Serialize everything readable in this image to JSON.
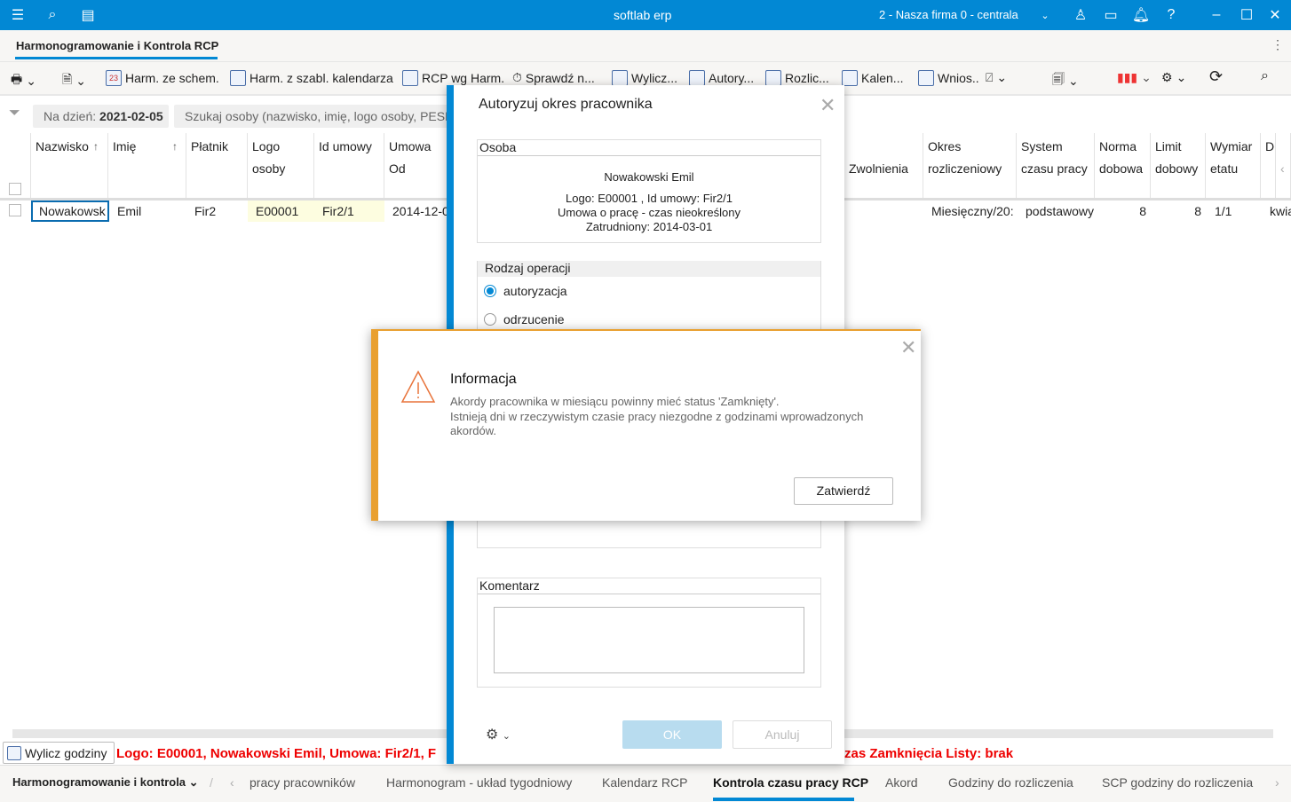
{
  "app": {
    "title": "softlab erp",
    "company": "2 - Nasza firma 0 - centrala"
  },
  "tab": {
    "label": "Harmonogramowanie i Kontrola RCP"
  },
  "toolbar": {
    "items": [
      "Harm. ze schem.",
      "Harm. z szabl. kalendarza",
      "RCP wg Harm.",
      "Sprawdź n...",
      "Wylicz...",
      "Autory...",
      "Rozlic...",
      "Kalen...",
      "Wnios.."
    ]
  },
  "filter": {
    "date_label": "Na dzień:",
    "date_value": "2021-02-05",
    "search_placeholder": "Szukaj osoby (nazwisko, imię, logo osoby, PESEL"
  },
  "table": {
    "headers": {
      "nazwisko": "Nazwisko",
      "imie": "Imię",
      "platnik": "Płatnik",
      "logo1": "Logo",
      "logo2": "osoby",
      "id_umowy": "Id umowy",
      "umowa": "Umowa",
      "od": "Od",
      "zwolnienia": "Zwolnienia",
      "okres1": "Okres",
      "okres2": "rozliczeniowy",
      "system1": "System",
      "system2": "czasu pracy",
      "norma1": "Norma",
      "norma2": "dobowa",
      "limit1": "Limit",
      "limit2": "dobowy",
      "wymiar1": "Wymiar",
      "wymiar2": "etatu",
      "d": "D:"
    },
    "row": {
      "nazwisko": "Nowakowsk",
      "imie": "Emil",
      "platnik": "Fir2",
      "logo": "E00001",
      "id_umowy": "Fir2/1",
      "od": "2014-12-0",
      "okres": "Miesięczny/20:",
      "system": "podstawowy",
      "norma": "8",
      "limit": "8",
      "wymiar": "1/1",
      "d": "kwia"
    }
  },
  "status": {
    "button": "Wylicz godziny",
    "text_left": "Logo: E00001, Nowakowski Emil, Umowa: Fir2/1, F",
    "text_right": "zas Zamknięcia Listy: brak"
  },
  "bottom_tabs": {
    "group": "Harmonogramowanie i kontrola",
    "items": [
      "pracy pracowników",
      "Harmonogram - układ tygodniowy",
      "Kalendarz RCP",
      "Kontrola czasu pracy RCP",
      "Akord",
      "Godziny do rozliczenia",
      "SCP godziny do rozliczenia"
    ]
  },
  "dialog": {
    "title": "Autoryzuj okres pracownika",
    "osoba_label": "Osoba",
    "person_name": "Nowakowski Emil",
    "person_line1": "Logo: E00001 , Id umowy: Fir2/1",
    "person_line2": "Umowa o pracę - czas nieokreślony",
    "person_line3": "Zatrudniony: 2014-03-01",
    "operation_label": "Rodzaj operacji",
    "options": [
      "autoryzacja",
      "odrzucenie"
    ],
    "selected": "autoryzacja",
    "comment_label": "Komentarz",
    "comment_value": "",
    "ok": "OK",
    "cancel": "Anuluj"
  },
  "info": {
    "title": "Informacja",
    "line1": "Akordy pracownika w miesiącu powinny mieć status 'Zamknięty'.",
    "line2": "Istnieją dni w rzeczywistym czasie pracy niezgodne z godzinami wprowadzonych akordów.",
    "confirm": "Zatwierdź",
    "accent": "#e9a030"
  }
}
